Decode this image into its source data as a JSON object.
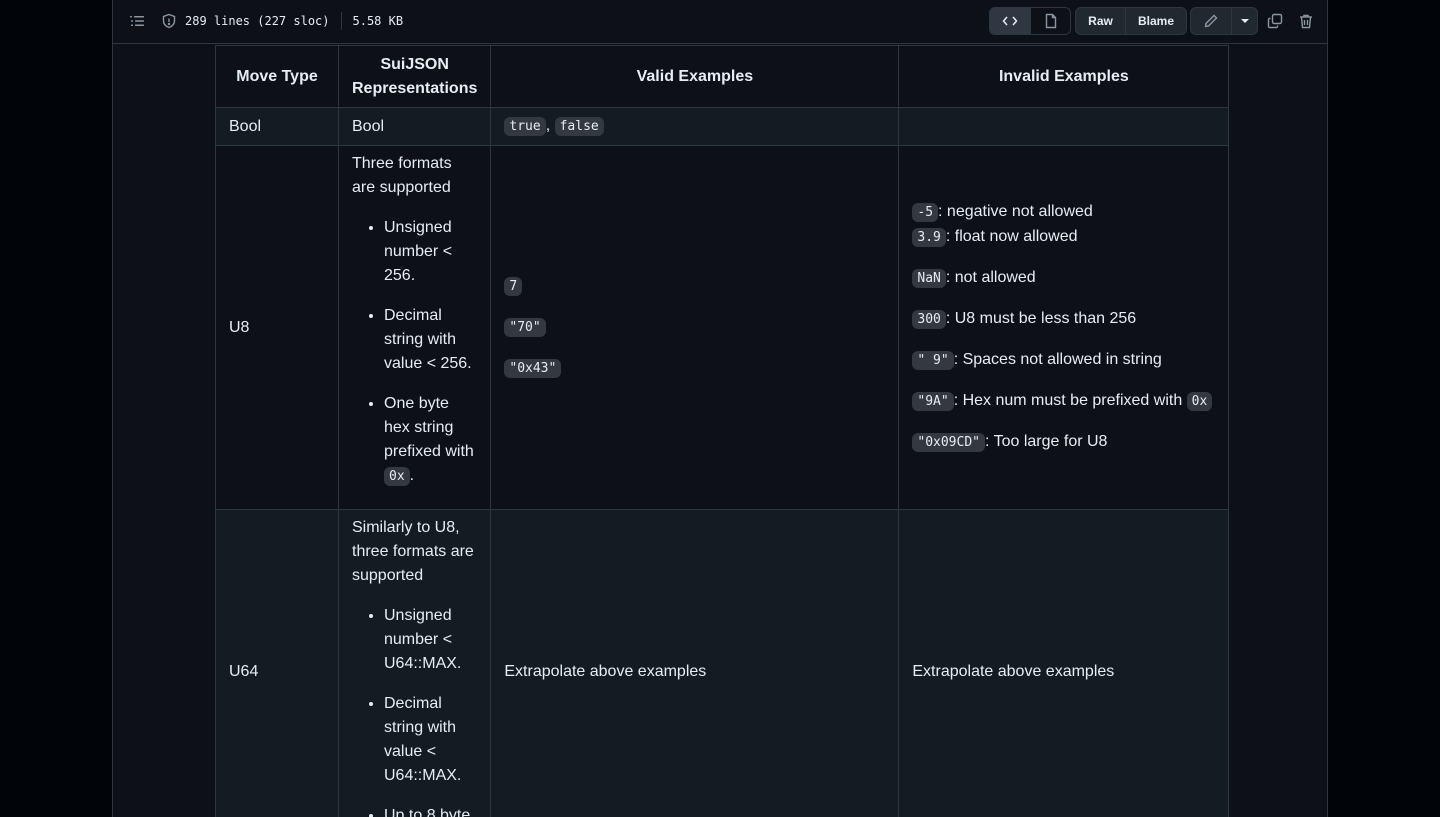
{
  "toolbar": {
    "lines_info": "289 lines (227 sloc)",
    "size": "5.58 KB",
    "raw_label": "Raw",
    "blame_label": "Blame"
  },
  "table": {
    "headers": [
      "Move Type",
      "SuiJSON Representations",
      "Valid Examples",
      "Invalid Examples"
    ],
    "bool": {
      "type": "Bool",
      "repr": "Bool",
      "valid_true": "true",
      "valid_sep": ",",
      "valid_false": "false"
    },
    "u8": {
      "type": "U8",
      "repr_intro": "Three formats are supported",
      "repr_items": [
        "Unsigned number < 256.",
        "Decimal string with value < 256.",
        "One byte hex string prefixed with "
      ],
      "repr_code": "0x",
      "repr_end": ".",
      "valid": [
        "7",
        "\"70\"",
        "\"0x43\""
      ],
      "invalid": [
        {
          "code": "-5",
          "text": ": negative not allowed"
        },
        {
          "code": "3.9",
          "text": ": float now allowed"
        },
        {
          "code": "NaN",
          "text": ": not allowed"
        },
        {
          "code": "300",
          "text": ": U8 must be less than 256"
        },
        {
          "code": "\" 9\"",
          "text": ": Spaces not allowed in string"
        },
        {
          "code": "\"9A\"",
          "text": ": Hex num must be prefixed with ",
          "code2": "0x"
        },
        {
          "code": "\"0x09CD\"",
          "text": ": Too large for U8"
        }
      ]
    },
    "u64": {
      "type": "U64",
      "repr_intro": "Similarly to U8, three formats are supported",
      "repr_items": [
        "Unsigned number < U64::MAX.",
        "Decimal string with value < U64::MAX.",
        "Up to 8 byte"
      ],
      "valid": "Extrapolate above examples",
      "invalid": "Extrapolate above examples"
    }
  }
}
